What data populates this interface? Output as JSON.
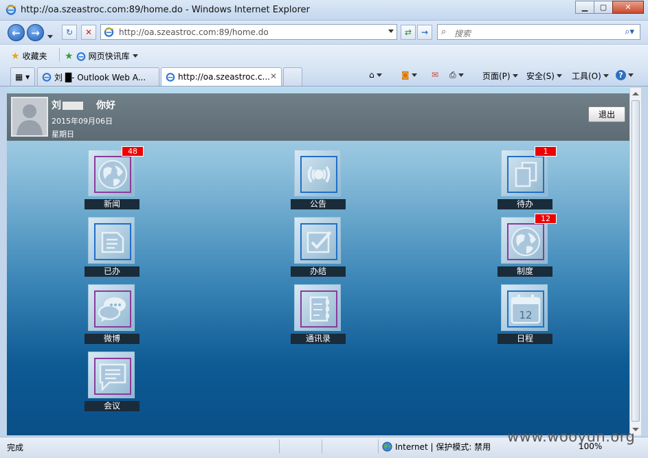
{
  "window": {
    "title": "http://oa.szeastroc.com:89/home.do - Windows Internet Explorer"
  },
  "navbar": {
    "url": "http://oa.szeastroc.com:89/home.do",
    "search_placeholder": "搜索"
  },
  "favorites": {
    "label": "收藏夹",
    "item": "网页快讯库"
  },
  "tabs": [
    {
      "label": "刘  █- Outlook Web A..."
    },
    {
      "label": "http://oa.szeastroc.c..."
    }
  ],
  "toolbar": {
    "page": "页面(P)",
    "safety": "安全(S)",
    "tools": "工具(O)"
  },
  "header": {
    "name": "刘",
    "greeting": "你好",
    "date": "2015年09月06日",
    "weekday": "星期日",
    "logout": "退出"
  },
  "apps": [
    {
      "label": "新闻",
      "badge": "48",
      "icon": "globe-icon"
    },
    {
      "label": "公告",
      "badge": "",
      "icon": "broadcast-icon"
    },
    {
      "label": "待办",
      "badge": "1",
      "icon": "documents-icon"
    },
    {
      "label": "已办",
      "badge": "",
      "icon": "document-icon"
    },
    {
      "label": "办结",
      "badge": "",
      "icon": "checkbox-icon"
    },
    {
      "label": "制度",
      "badge": "12",
      "icon": "globe-icon"
    },
    {
      "label": "微博",
      "badge": "",
      "icon": "chat-bubbles-icon"
    },
    {
      "label": "通讯录",
      "badge": "",
      "icon": "address-book-icon"
    },
    {
      "label": "日程",
      "badge": "",
      "icon": "calendar-icon",
      "calendar_day": "12"
    },
    {
      "label": "会议",
      "badge": "",
      "icon": "message-icon"
    }
  ],
  "status": {
    "text": "完成",
    "zone": "Internet | 保护模式: 禁用",
    "zoom": "100%"
  },
  "watermark": "www.wooyun.org",
  "colors": {
    "badge": "#ee0000",
    "label_bg": "#1a2b3a",
    "header_bg": "#66757e"
  }
}
